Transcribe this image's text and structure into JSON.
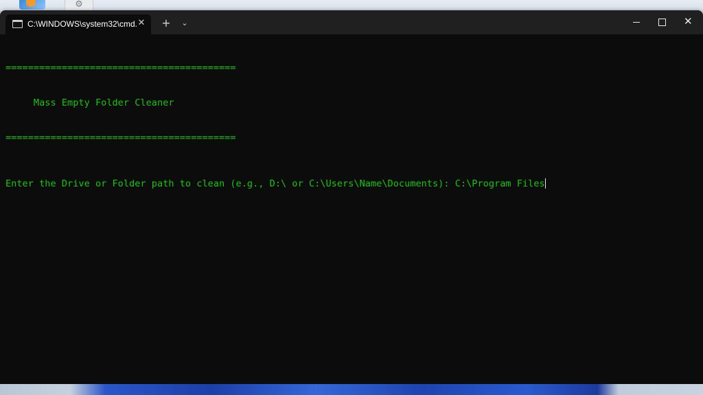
{
  "window": {
    "tab_title": "C:\\WINDOWS\\system32\\cmd.",
    "tab_icon": "terminal-icon",
    "close_tab_symbol": "✕",
    "new_tab_symbol": "+",
    "dropdown_symbol": "⌄",
    "close_window_symbol": "✕"
  },
  "console": {
    "separator_top": "=========================================",
    "heading": "     Mass Empty Folder Cleaner",
    "separator_bottom": "=========================================",
    "prompt": "Enter the Drive or Folder path to clean (e.g., D:\\ or C:\\Users\\Name\\Documents): ",
    "input_value": "C:\\Program Files"
  },
  "colors": {
    "console_text": "#16c60c",
    "console_background": "#0c0c0c",
    "titlebar": "#202020"
  }
}
